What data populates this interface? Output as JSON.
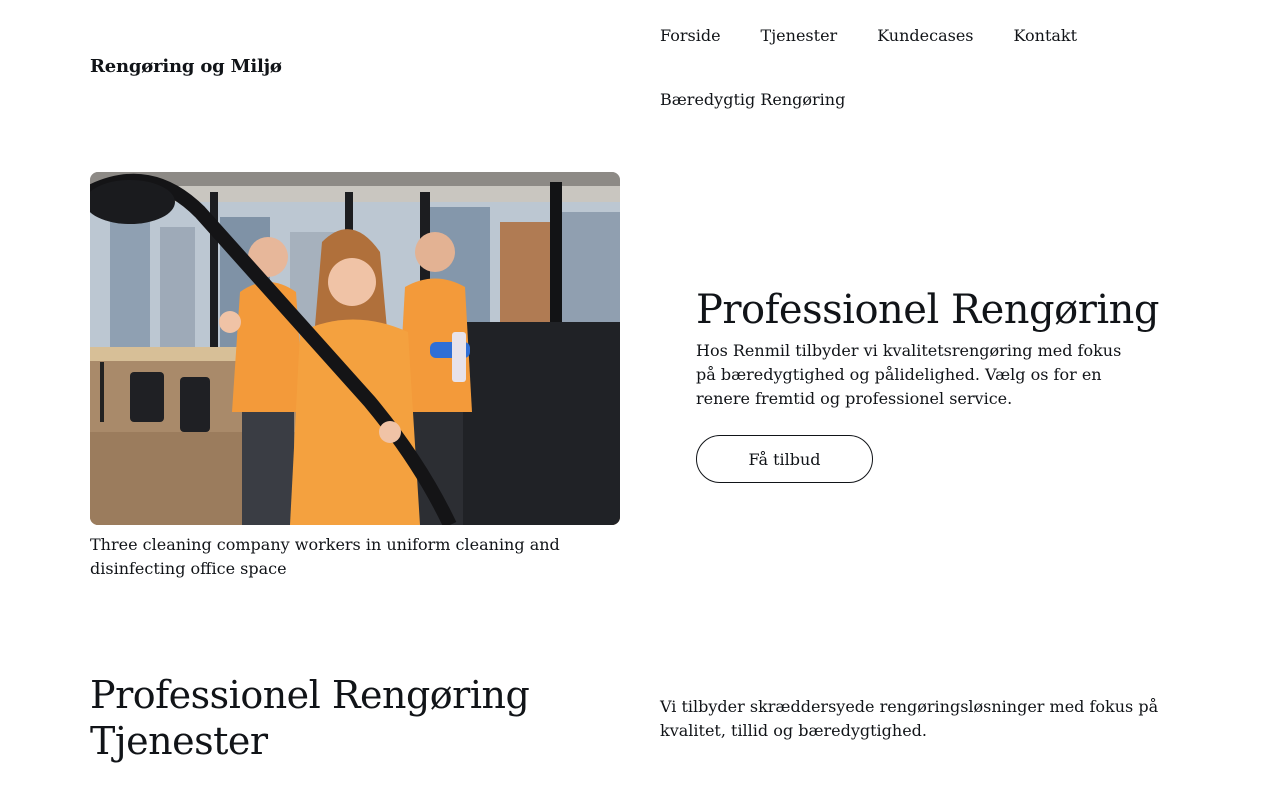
{
  "header": {
    "brand": "Rengøring og Miljø",
    "nav": [
      "Forside",
      "Tjenester",
      "Kundecases",
      "Kontakt",
      "Bæredygtig Rengøring"
    ]
  },
  "hero": {
    "caption": "Three cleaning company workers in uniform cleaning and disinfecting office space",
    "title": "Professionel Rengøring",
    "description": "Hos Renmil tilbyder vi kvalitetsrengøring med fokus på bæredygtighed og pålidelighed. Vælg os for en renere fremtid og professionel service.",
    "cta_label": "Få tilbud"
  },
  "services": {
    "title": "Professionel Rengøring Tjenester",
    "description": "Vi tilbyder skræddersyede rengøringsløsninger med fokus på kvalitet, tillid og bæredygtighed."
  },
  "colors": {
    "text": "#111418",
    "background": "#ffffff",
    "uniform": "#f39a3a"
  }
}
